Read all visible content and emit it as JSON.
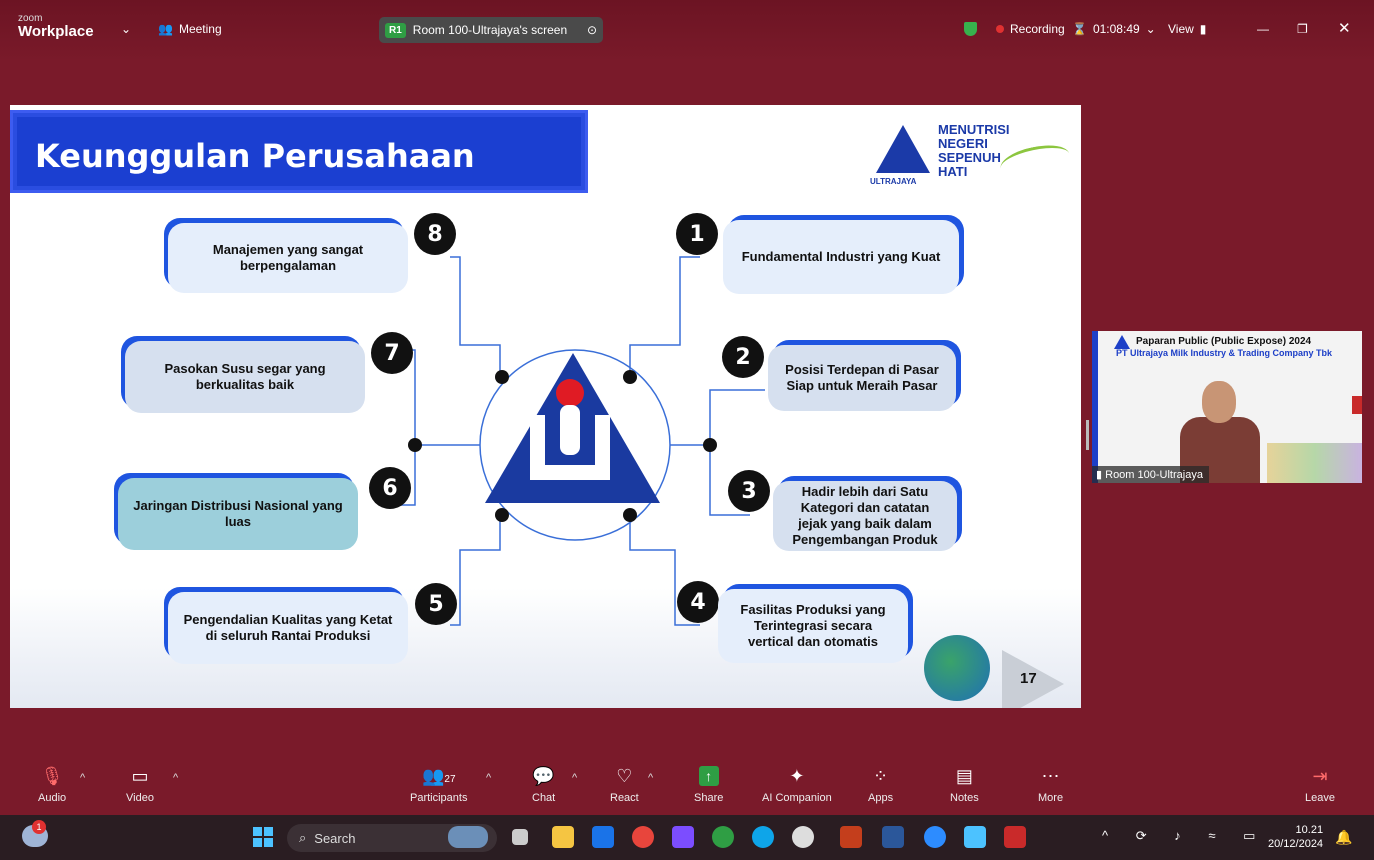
{
  "window": {
    "brand_small": "zoom",
    "brand_big": "Workplace",
    "meeting_label": "Meeting",
    "room_badge": "R1",
    "screen_label": "Room 100-Ultrajaya's screen",
    "recording_label": "Recording",
    "timer": "01:08:49",
    "view_label": "View"
  },
  "slide": {
    "title": "Keunggulan Perusahaan",
    "logo_name": "ULTRAJAYA",
    "tagline": [
      "MENUTRISI",
      "NEGERI",
      "SEPENUH",
      "HATI"
    ],
    "page_number": "17",
    "items": [
      {
        "num": "1",
        "text": "Fundamental Industri yang Kuat"
      },
      {
        "num": "2",
        "text": "Posisi Terdepan di Pasar Siap untuk Meraih Pasar"
      },
      {
        "num": "3",
        "text": "Hadir lebih dari Satu Kategori dan catatan jejak yang baik dalam Pengembangan Produk"
      },
      {
        "num": "4",
        "text": "Fasilitas Produksi yang Terintegrasi secara vertical dan otomatis"
      },
      {
        "num": "5",
        "text": "Pengendalian Kualitas yang Ketat di seluruh Rantai Produksi"
      },
      {
        "num": "6",
        "text": "Jaringan Distribusi Nasional yang luas"
      },
      {
        "num": "7",
        "text": "Pasokan Susu segar yang berkualitas baik"
      },
      {
        "num": "8",
        "text": "Manajemen yang sangat berpengalaman"
      }
    ]
  },
  "video_tile": {
    "title": "Paparan Public (Public Expose) 2024",
    "subtitle": "PT Ultrajaya Milk Industry & Trading Company Tbk",
    "participant": "Room 100-Ultrajaya"
  },
  "toolbar": {
    "audio": "Audio",
    "video": "Video",
    "participants": "Participants",
    "participants_count": "27",
    "chat": "Chat",
    "react": "React",
    "share": "Share",
    "ai_companion": "AI Companion",
    "apps": "Apps",
    "notes": "Notes",
    "more": "More",
    "leave": "Leave"
  },
  "taskbar": {
    "search_placeholder": "Search",
    "time": "10.21",
    "date": "20/12/2024",
    "weather_badge": "1"
  },
  "colors": {
    "zoom_bg": "#7a1a2a",
    "slide_title_bg": "#1b3fd1",
    "box_border": "#1f55e0",
    "share_green": "#2f9e44",
    "record_red": "#e03131"
  }
}
